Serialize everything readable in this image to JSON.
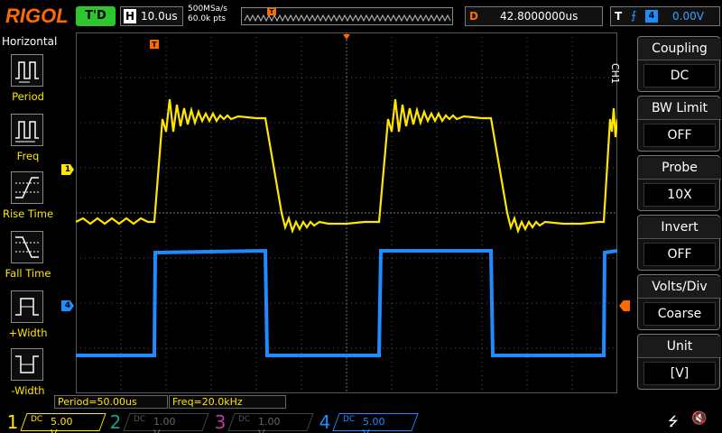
{
  "header": {
    "logo": "RIGOL",
    "run_status": "T'D",
    "timebase_label": "H",
    "timebase_value": "10.0us",
    "sample_rate": "500MSa/s",
    "memory_depth": "60.0k pts",
    "trigger_marker": "T",
    "delay_label": "D",
    "delay_value": "42.8000000us",
    "trigger_label": "T",
    "trigger_edge": "rising-edge-icon",
    "trigger_source": "4",
    "trigger_level": "0.00V"
  },
  "left_menu": {
    "title": "Horizontal",
    "items": [
      {
        "label": "Period",
        "icon": "period-icon"
      },
      {
        "label": "Freq",
        "icon": "frequency-icon"
      },
      {
        "label": "Rise Time",
        "icon": "rise-time-icon"
      },
      {
        "label": "Fall Time",
        "icon": "fall-time-icon"
      },
      {
        "label": "+Width",
        "icon": "positive-width-icon"
      },
      {
        "label": "-Width",
        "icon": "negative-width-icon"
      }
    ]
  },
  "screen": {
    "trigger_position_marker": "T",
    "ch1_marker": "1",
    "ch4_marker": "4"
  },
  "right_menu": {
    "channel": "CH1",
    "items": [
      {
        "title": "Coupling",
        "value": "DC"
      },
      {
        "title": "BW Limit",
        "value": "OFF"
      },
      {
        "title": "Probe",
        "value": "10X"
      },
      {
        "title": "Invert",
        "value": "OFF"
      },
      {
        "title": "Volts/Div",
        "value": "Coarse"
      },
      {
        "title": "Unit",
        "value": "[V]"
      }
    ]
  },
  "measurements": {
    "period": "Period=50.00us",
    "freq": "Freq=20.0kHz"
  },
  "channels": [
    {
      "num": "1",
      "coupling": "DC",
      "scale": "5.00 V",
      "color": "#ffe600",
      "active": true
    },
    {
      "num": "2",
      "coupling": "DC",
      "scale": "1.00 V",
      "color": "#1aa08a",
      "active": false
    },
    {
      "num": "3",
      "coupling": "DC",
      "scale": "1.00 V",
      "color": "#c0389a",
      "active": false
    },
    {
      "num": "4",
      "coupling": "DC",
      "scale": "5.00 V",
      "color": "#1e8bff",
      "active": true
    }
  ],
  "status_icons": {
    "usb": "usb-icon",
    "speaker": "speaker-muted-icon"
  }
}
